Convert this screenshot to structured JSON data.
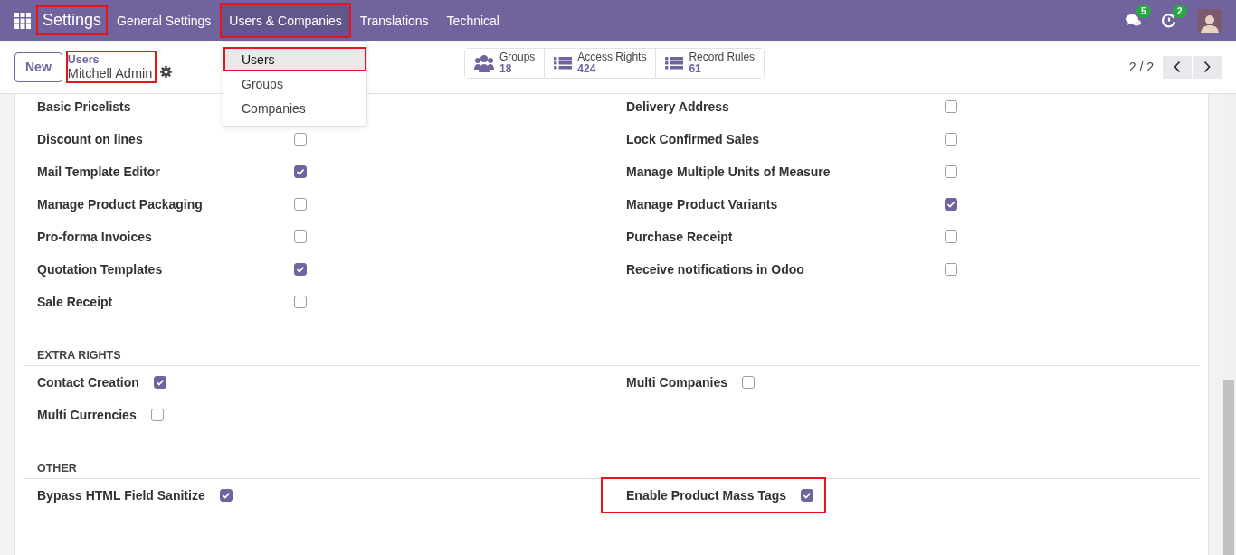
{
  "navbar": {
    "app_title": {
      "text": "Settings",
      "highlighted": true
    },
    "menus": [
      {
        "label": "General Settings",
        "open": false,
        "highlighted": false
      },
      {
        "label": "Users & Companies",
        "open": true,
        "highlighted": true
      },
      {
        "label": "Translations",
        "open": false,
        "highlighted": false
      },
      {
        "label": "Technical",
        "open": false,
        "highlighted": false
      }
    ],
    "notifications": [
      {
        "kind": "chat",
        "count": "5"
      },
      {
        "kind": "activity",
        "count": "2"
      }
    ]
  },
  "control_panel": {
    "new_button": "New",
    "breadcrumb": {
      "parent": "Users",
      "current": "Mitchell Admin",
      "highlighted": true
    },
    "stat_buttons": [
      {
        "kind": "groups",
        "label": "Groups",
        "value": "18"
      },
      {
        "kind": "list",
        "label": "Access Rights",
        "value": "424"
      },
      {
        "kind": "list",
        "label": "Record Rules",
        "value": "61"
      }
    ],
    "pager": "2 / 2"
  },
  "dropdown": {
    "items": [
      {
        "label": "Users",
        "selected": true,
        "highlighted": true
      },
      {
        "label": "Groups",
        "selected": false,
        "highlighted": false
      },
      {
        "label": "Companies",
        "selected": false,
        "highlighted": false
      }
    ]
  },
  "sections": [
    {
      "kind": "grid",
      "fields": [
        {
          "label": "Basic Pricelists"
        },
        {
          "label": "Delivery Address",
          "checked": false
        },
        {
          "label": "Discount on lines",
          "checked": false
        },
        {
          "label": "Lock Confirmed Sales",
          "checked": false
        },
        {
          "label": "Mail Template Editor",
          "checked": true
        },
        {
          "label": "Manage Multiple Units of Measure",
          "checked": false
        },
        {
          "label": "Manage Product Packaging",
          "checked": false
        },
        {
          "label": "Manage Product Variants",
          "checked": true
        },
        {
          "label": "Pro-forma Invoices",
          "checked": false
        },
        {
          "label": "Purchase Receipt",
          "checked": false
        },
        {
          "label": "Quotation Templates",
          "checked": true
        },
        {
          "label": "Receive notifications in Odoo",
          "checked": false
        },
        {
          "label": "Sale Receipt",
          "checked": false
        }
      ]
    },
    {
      "kind": "inline",
      "title": "EXTRA RIGHTS",
      "fields": [
        {
          "label": "Contact Creation",
          "checked": true,
          "highlighted": false
        },
        {
          "label": "Multi Companies",
          "checked": false,
          "highlighted": false
        },
        {
          "label": "Multi Currencies",
          "checked": false,
          "highlighted": false
        }
      ]
    },
    {
      "kind": "inline",
      "title": "OTHER",
      "fields": [
        {
          "label": "Bypass HTML Field Sanitize",
          "checked": true,
          "highlighted": false
        },
        {
          "label": "Enable Product Mass Tags",
          "checked": true,
          "highlighted": true
        }
      ]
    }
  ]
}
